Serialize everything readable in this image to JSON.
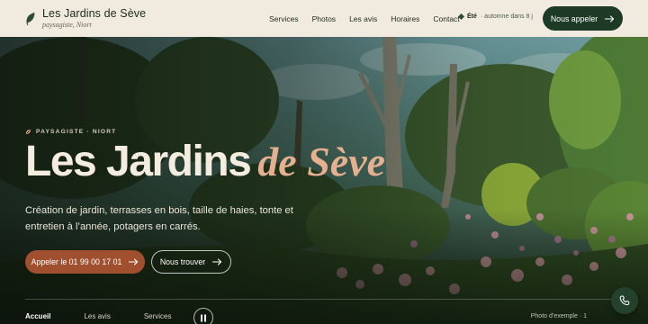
{
  "brand": {
    "title": "Les Jardins de Sève",
    "subtitle": "paysagiste, Niort"
  },
  "nav": {
    "items": [
      {
        "label": "Services"
      },
      {
        "label": "Photos"
      },
      {
        "label": "Les avis"
      },
      {
        "label": "Horaires"
      },
      {
        "label": "Contact"
      }
    ]
  },
  "season": {
    "name": "Été",
    "note": "· automne dans 8 j"
  },
  "header_cta": {
    "label": "Nous appeler"
  },
  "hero": {
    "eyebrow": "PAYSAGISTE · NIORT",
    "headline_main": "Les Jardins",
    "headline_accent": "de Sève",
    "lead": "Création de jardin, terrasses en bois, taille de haies, tonte et entretien à l’année, potagers en carrés.",
    "primary_button": "Appeler le 01 99 00 17 01",
    "secondary_button": "Nous trouver",
    "tabs": [
      {
        "label": "Accueil",
        "active": true
      },
      {
        "label": "Les avis",
        "active": false
      },
      {
        "label": "Services",
        "active": false
      }
    ],
    "photo_caption": "Photo d’exemple · 1"
  },
  "icons": {
    "brand": "leaf-icon",
    "eyebrow": "leaf-icon",
    "season": "diamond-icon",
    "arrow": "arrow-right-icon",
    "pause": "pause-icon",
    "phone": "phone-icon"
  },
  "colors": {
    "header_bg": "#f1ebdf",
    "dark_green": "#1d3a27",
    "terracotta": "#a0502f",
    "accent_peach": "#e4b08f",
    "headline_cream": "#f3ecdf"
  }
}
